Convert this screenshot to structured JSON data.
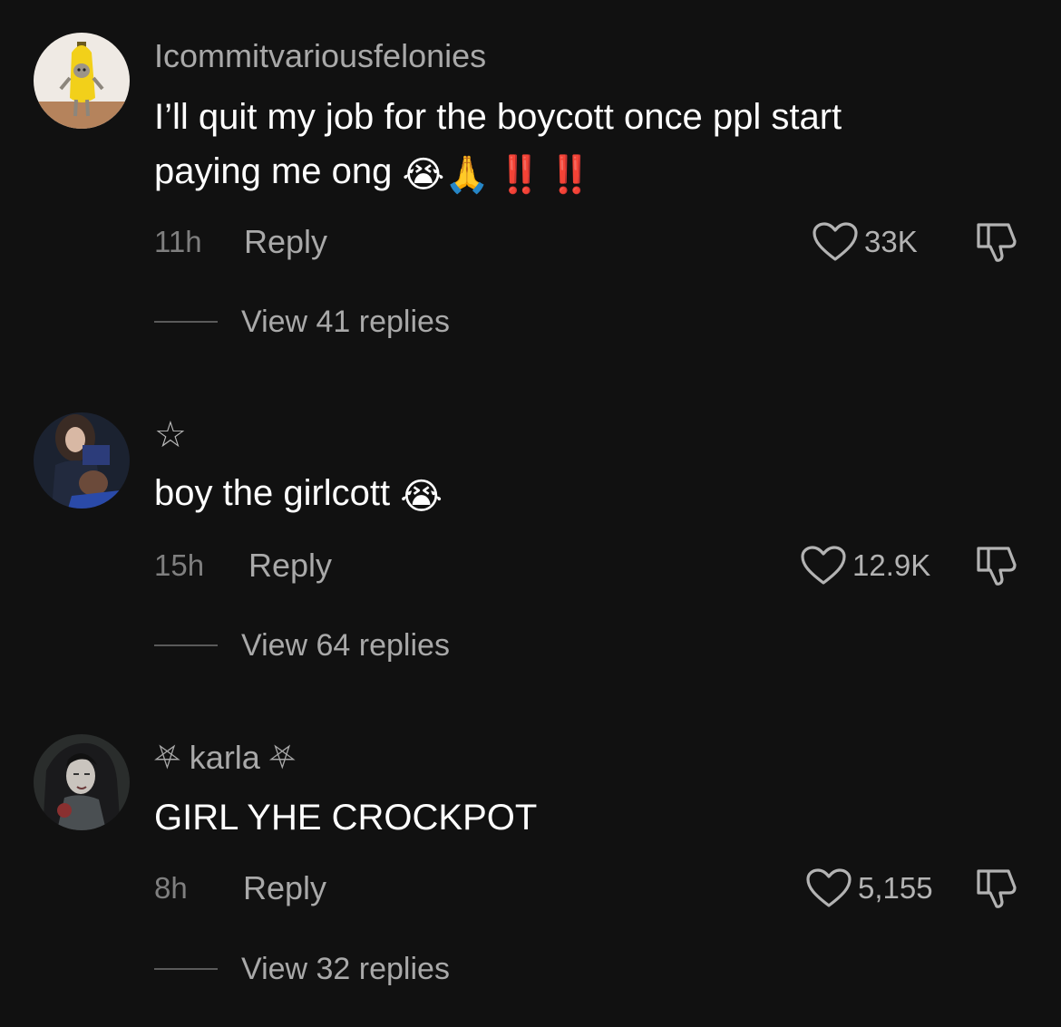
{
  "comments": [
    {
      "username": "Icommitvariousfelonies",
      "text_line1": "I’ll quit my job for the boycott once ppl start",
      "text_line2": "paying me ong",
      "emoji1": "😭",
      "emoji2": "🙏",
      "bang1": "‼️",
      "bang2": "‼️",
      "time": "11h",
      "reply_label": "Reply",
      "likes": "33K",
      "view_replies": "View 41 replies"
    },
    {
      "username": "☆",
      "text": "boy the girlcott",
      "emoji1": "😭",
      "time": "15h",
      "reply_label": "Reply",
      "likes": "12.9K",
      "view_replies": "View 64 replies"
    },
    {
      "username": "⛧ karla ⛧",
      "text": "GIRL YHE CROCKPOT",
      "time": "8h",
      "reply_label": "Reply",
      "likes": "5,155",
      "view_replies": "View 32 replies"
    }
  ],
  "colors": {
    "background": "#111111",
    "text": "#ffffff",
    "secondary": "#a9a9a9",
    "muted": "#7f7f7f",
    "emphasis_red": "#e8161b"
  },
  "icons": [
    "heart-outline-icon",
    "thumbs-down-icon"
  ]
}
